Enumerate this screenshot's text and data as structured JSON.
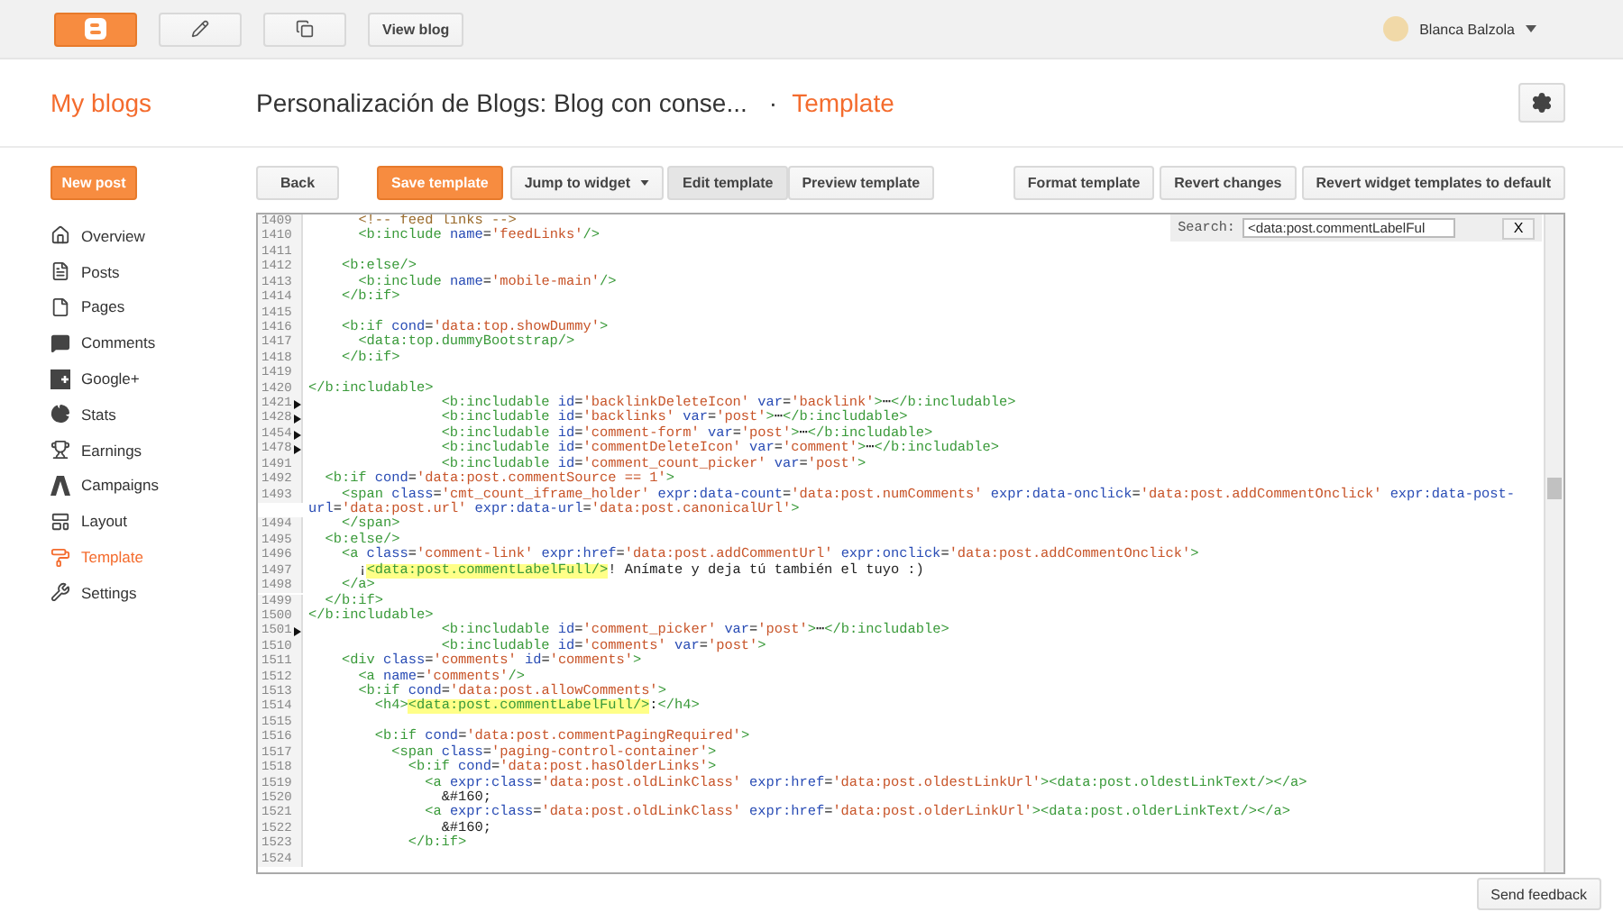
{
  "top_bar": {
    "view_blog": "View blog",
    "user_name": "Blanca Balzola"
  },
  "header": {
    "my_blogs": "My blogs",
    "blog_title": "Personalización de Blogs: Blog con conse...",
    "separator": "·",
    "section": "Template"
  },
  "sidebar": {
    "new_post": "New post",
    "items": [
      {
        "kind": "overview",
        "label": "Overview",
        "selected": false
      },
      {
        "kind": "posts",
        "label": "Posts",
        "selected": false
      },
      {
        "kind": "pages",
        "label": "Pages",
        "selected": false
      },
      {
        "kind": "comments",
        "label": "Comments",
        "selected": false
      },
      {
        "kind": "googleplus",
        "label": "Google+",
        "selected": false
      },
      {
        "kind": "stats",
        "label": "Stats",
        "selected": false
      },
      {
        "kind": "earnings",
        "label": "Earnings",
        "selected": false
      },
      {
        "kind": "campaigns",
        "label": "Campaigns",
        "selected": false
      },
      {
        "kind": "layout",
        "label": "Layout",
        "selected": false
      },
      {
        "kind": "template",
        "label": "Template",
        "selected": true
      },
      {
        "kind": "settings",
        "label": "Settings",
        "selected": false
      }
    ]
  },
  "toolbar": {
    "back": "Back",
    "save": "Save template",
    "jump": "Jump to widget",
    "modes": [
      {
        "label": "Edit template",
        "selected": true
      },
      {
        "label": "Preview template",
        "selected": false
      }
    ],
    "right_buttons": [
      "Format template",
      "Revert changes",
      "Revert widget templates to default"
    ]
  },
  "search": {
    "label": "Search:",
    "value": "<data:post.commentLabelFul",
    "close": "X"
  },
  "code_lines": [
    {
      "number": "1409",
      "folded": false,
      "parts": [
        {
          "text": "      <!-- feed links -->",
          "highlighted": false
        }
      ]
    },
    {
      "number": "1410",
      "folded": false,
      "parts": [
        {
          "text": "      <b:include name='feedLinks'/>",
          "highlighted": false
        }
      ]
    },
    {
      "number": "1411",
      "folded": false
    },
    {
      "number": "1412",
      "folded": false,
      "parts": [
        {
          "text": "    <b:else/>",
          "highlighted": false
        }
      ]
    },
    {
      "number": "1413",
      "folded": false,
      "parts": [
        {
          "text": "      <b:include name='mobile-main'/>",
          "highlighted": false
        }
      ]
    },
    {
      "number": "1414",
      "folded": false,
      "parts": [
        {
          "text": "    </b:if>",
          "highlighted": false
        }
      ]
    },
    {
      "number": "1415",
      "folded": false
    },
    {
      "number": "1416",
      "folded": false,
      "parts": [
        {
          "text": "    <b:if cond='data:top.showDummy'>",
          "highlighted": false
        }
      ]
    },
    {
      "number": "1417",
      "folded": false,
      "parts": [
        {
          "text": "      <data:top.dummyBootstrap/>",
          "highlighted": false
        }
      ]
    },
    {
      "number": "1418",
      "folded": false,
      "parts": [
        {
          "text": "    </b:if>",
          "highlighted": false
        }
      ]
    },
    {
      "number": "1419",
      "folded": false
    },
    {
      "number": "1420",
      "folded": false,
      "parts": [
        {
          "text": "</b:includable>",
          "highlighted": false
        }
      ]
    },
    {
      "number": "1421",
      "folded": true,
      "parts": [
        {
          "text": "                <b:includable id='backlinkDeleteIcon' var='backlink'>⋯</b:includable>",
          "highlighted": false
        }
      ]
    },
    {
      "number": "1428",
      "folded": true,
      "parts": [
        {
          "text": "                <b:includable id='backlinks' var='post'>⋯</b:includable>",
          "highlighted": false
        }
      ]
    },
    {
      "number": "1454",
      "folded": true,
      "parts": [
        {
          "text": "                <b:includable id='comment-form' var='post'>⋯</b:includable>",
          "highlighted": false
        }
      ]
    },
    {
      "number": "1478",
      "folded": true,
      "parts": [
        {
          "text": "                <b:includable id='commentDeleteIcon' var='comment'>⋯</b:includable>",
          "highlighted": false
        }
      ]
    },
    {
      "number": "1491",
      "folded": false,
      "parts": [
        {
          "text": "                <b:includable id='comment_count_picker' var='post'>",
          "highlighted": false
        }
      ]
    },
    {
      "number": "1492",
      "folded": false,
      "parts": [
        {
          "text": "  <b:if cond='data:post.commentSource == 1'>",
          "highlighted": false
        }
      ]
    },
    {
      "number": "1493",
      "folded": false,
      "parts": [
        {
          "text": "    <span class='cmt_count_iframe_holder' expr:data-count='data:post.numComments' expr:data-onclick='data:post.addCommentOnclick' expr:data-post-url='data:post.url' expr:data-url='data:post.canonicalUrl'>",
          "highlighted": false
        }
      ]
    },
    {
      "number": "1494",
      "folded": false,
      "parts": [
        {
          "text": "    </span>",
          "highlighted": false
        }
      ]
    },
    {
      "number": "1495",
      "folded": false,
      "parts": [
        {
          "text": "  <b:else/>",
          "highlighted": false
        }
      ]
    },
    {
      "number": "1496",
      "folded": false,
      "parts": [
        {
          "text": "    <a class='comment-link' expr:href='data:post.addCommentUrl' expr:onclick='data:post.addCommentOnclick'>",
          "highlighted": false
        }
      ]
    },
    {
      "number": "1497",
      "folded": false,
      "parts": [
        {
          "text": "      ¡",
          "highlighted": false
        },
        {
          "text": "<data:post.commentLabelFull/>",
          "highlighted": true
        },
        {
          "text": "! Anímate y deja tú también el tuyo :)",
          "highlighted": false
        }
      ]
    },
    {
      "number": "1498",
      "folded": false,
      "parts": [
        {
          "text": "    </a>",
          "highlighted": false
        }
      ]
    },
    {
      "number": "1499",
      "folded": false,
      "parts": [
        {
          "text": "  </b:if>",
          "highlighted": false
        }
      ]
    },
    {
      "number": "1500",
      "folded": false,
      "parts": [
        {
          "text": "</b:includable>",
          "highlighted": false
        }
      ]
    },
    {
      "number": "1501",
      "folded": true,
      "parts": [
        {
          "text": "                <b:includable id='comment_picker' var='post'>⋯</b:includable>",
          "highlighted": false
        }
      ]
    },
    {
      "number": "1510",
      "folded": false,
      "parts": [
        {
          "text": "                <b:includable id='comments' var='post'>",
          "highlighted": false
        }
      ]
    },
    {
      "number": "1511",
      "folded": false,
      "parts": [
        {
          "text": "    <div class='comments' id='comments'>",
          "highlighted": false
        }
      ]
    },
    {
      "number": "1512",
      "folded": false,
      "parts": [
        {
          "text": "      <a name='comments'/>",
          "highlighted": false
        }
      ]
    },
    {
      "number": "1513",
      "folded": false,
      "parts": [
        {
          "text": "      <b:if cond='data:post.allowComments'>",
          "highlighted": false
        }
      ]
    },
    {
      "number": "1514",
      "folded": false,
      "parts": [
        {
          "text": "        <h4>",
          "highlighted": false
        },
        {
          "text": "<data:post.commentLabelFull/>",
          "highlighted": true
        },
        {
          "text": ":</h4>",
          "highlighted": false
        }
      ]
    },
    {
      "number": "1515",
      "folded": false
    },
    {
      "number": "1516",
      "folded": false,
      "parts": [
        {
          "text": "        <b:if cond='data:post.commentPagingRequired'>",
          "highlighted": false
        }
      ]
    },
    {
      "number": "1517",
      "folded": false,
      "parts": [
        {
          "text": "          <span class='paging-control-container'>",
          "highlighted": false
        }
      ]
    },
    {
      "number": "1518",
      "folded": false,
      "parts": [
        {
          "text": "            <b:if cond='data:post.hasOlderLinks'>",
          "highlighted": false
        }
      ]
    },
    {
      "number": "1519",
      "folded": false,
      "parts": [
        {
          "text": "              <a expr:class='data:post.oldLinkClass' expr:href='data:post.oldestLinkUrl'><data:post.oldestLinkText/></a>",
          "highlighted": false
        }
      ]
    },
    {
      "number": "1520",
      "folded": false,
      "parts": [
        {
          "text": "                &#160;",
          "highlighted": false
        }
      ]
    },
    {
      "number": "1521",
      "folded": false,
      "parts": [
        {
          "text": "              <a expr:class='data:post.oldLinkClass' expr:href='data:post.olderLinkUrl'><data:post.olderLinkText/></a>",
          "highlighted": false
        }
      ]
    },
    {
      "number": "1522",
      "folded": false,
      "parts": [
        {
          "text": "                &#160;",
          "highlighted": false
        }
      ]
    },
    {
      "number": "1523",
      "folded": false,
      "parts": [
        {
          "text": "            </b:if>",
          "highlighted": false
        }
      ]
    },
    {
      "number": "1524",
      "folded": false
    }
  ],
  "feedback": "Send feedback"
}
